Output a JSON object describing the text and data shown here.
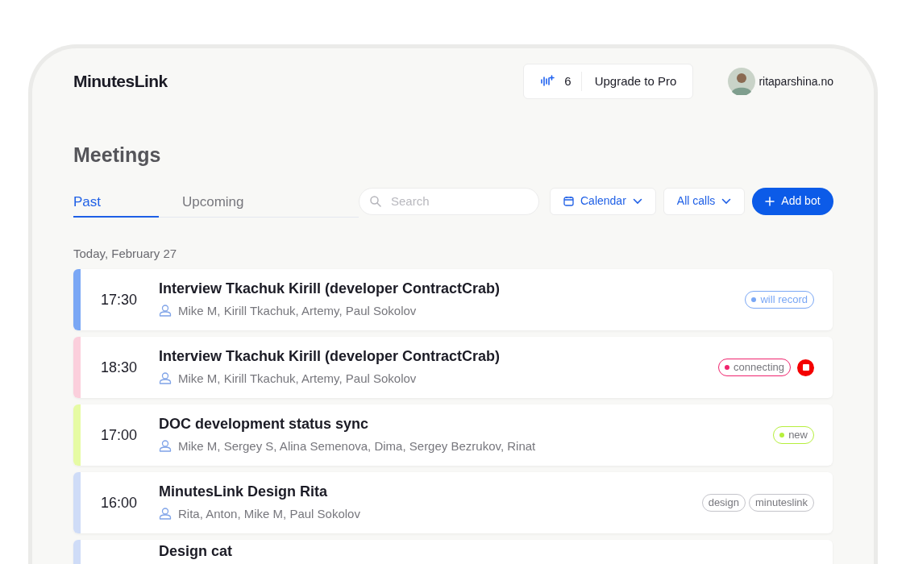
{
  "logo": "MinutesLink",
  "header": {
    "credits": "6",
    "upgrade": "Upgrade to Pro",
    "user": "ritaparshina.no"
  },
  "title": "Meetings",
  "tabs": [
    {
      "label": "Past",
      "selected": true
    },
    {
      "label": "Upcoming",
      "selected": false
    }
  ],
  "search": {
    "placeholder": "Search"
  },
  "filters": [
    {
      "label": "Calendar",
      "kind": "calendar"
    },
    {
      "label": "All calls",
      "kind": "plain"
    }
  ],
  "add_button": "Add bot",
  "date_heading": "Today, February 27",
  "meetings": [
    {
      "time": "17:30",
      "title": "Interview Tkachuk Kirill (developer ContractCrab)",
      "participants": "Mike M, Kirill Tkachuk, Artemy, Paul Sokolov",
      "color": "#7aa7f5",
      "tags": [
        {
          "label": "will record",
          "kind": "status",
          "color": "#7aa7f5"
        }
      ],
      "stop_button": false
    },
    {
      "time": "18:30",
      "title": "Interview Tkachuk Kirill (developer ContractCrab)",
      "participants": "Mike M, Kirill Tkachuk, Artemy, Paul Sokolov",
      "color": "#fbcfdc",
      "tags": [
        {
          "label": "connecting",
          "kind": "status",
          "color": "#f0246e"
        }
      ],
      "stop_button": true
    },
    {
      "time": "17:00",
      "title": "DOC development status sync",
      "participants": "Mike M, Sergey S, Alina Semenova, Dima, Sergey Bezrukov, Rinat",
      "color": "#e6fba4",
      "tags": [
        {
          "label": "new",
          "kind": "status",
          "color": "#b6ef3c"
        }
      ],
      "stop_button": false
    },
    {
      "time": "16:00",
      "title": "MinutesLink Design Rita",
      "participants": "Rita, Anton, Mike M, Paul Sokolov",
      "color": "#cfdcf7",
      "tags": [
        {
          "label": "design",
          "kind": "label"
        },
        {
          "label": "minuteslink",
          "kind": "label"
        }
      ],
      "stop_button": false
    },
    {
      "title": "Design cat",
      "color": "#cfdcf7",
      "stop_button": false
    }
  ]
}
